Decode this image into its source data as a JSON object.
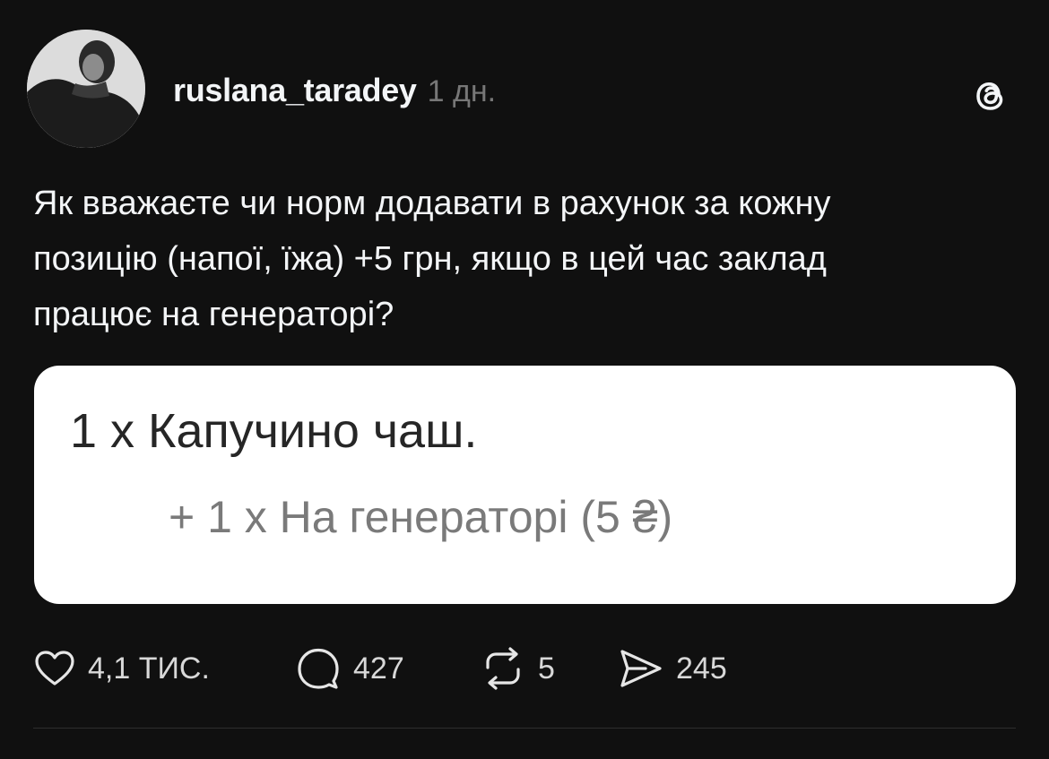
{
  "post": {
    "username": "ruslana_taradey",
    "timestamp": "1 дн.",
    "app_logo_icon": "threads-logo-icon",
    "text": "Як вважаєте чи норм додавати в рахунок за кожну\nпозицію (напої, їжа) +5 грн, якщо в цей час заклад\nпрацює на генераторі?",
    "media": {
      "line1": "1 x Капучино чаш.",
      "line2": "+ 1 x На генераторі (5 ₴)"
    },
    "actions": {
      "like": {
        "icon": "heart-icon",
        "count": "4,1 ТИС."
      },
      "reply": {
        "icon": "comment-icon",
        "count": "427"
      },
      "repost": {
        "icon": "repost-icon",
        "count": "5"
      },
      "share": {
        "icon": "send-icon",
        "count": "245"
      }
    }
  },
  "colors": {
    "background": "#101010",
    "text": "#f3f5f7",
    "muted": "#777777",
    "media_background": "#ffffff"
  }
}
